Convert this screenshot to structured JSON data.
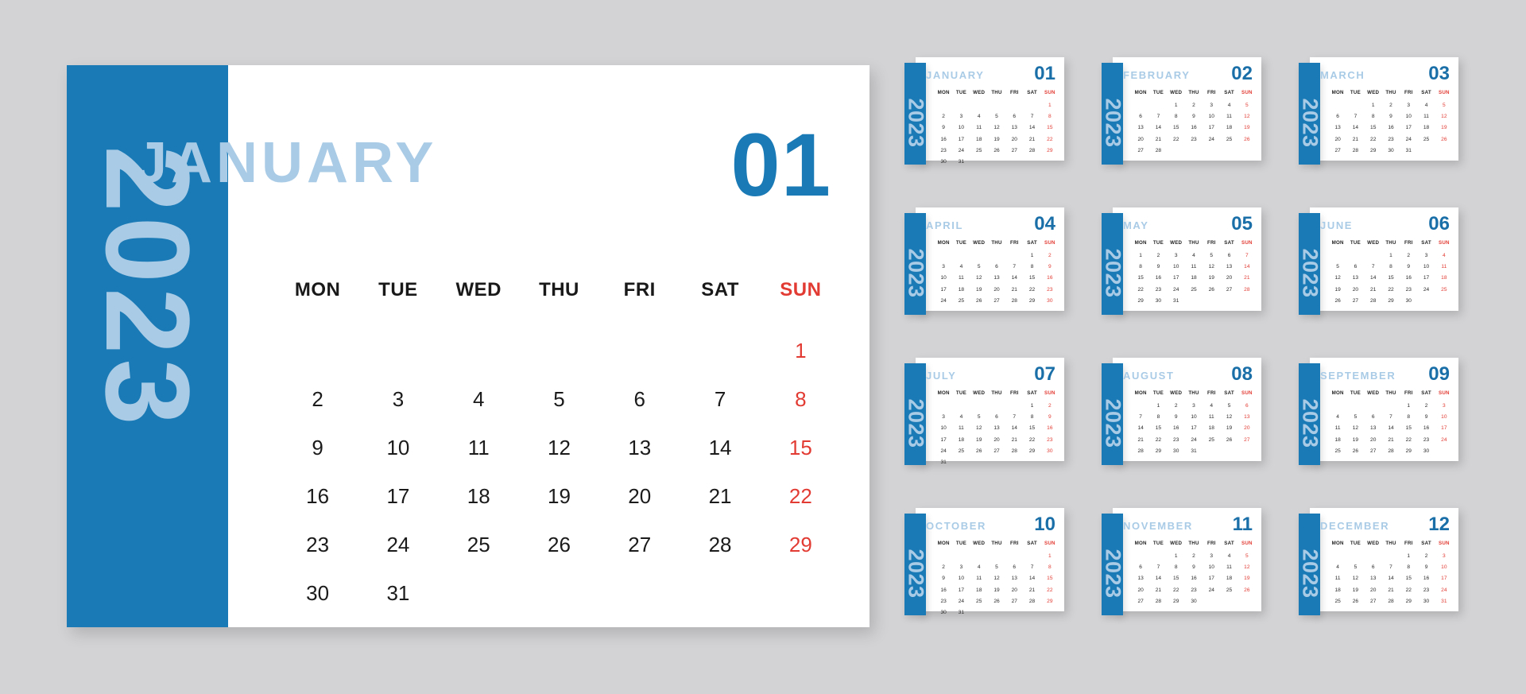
{
  "theme": {
    "background": "#d3d3d5",
    "card_background": "#ffffff",
    "accent_blue": "#1a7ab5",
    "light_blue": "#a9cbe6",
    "number_blue": "#1a6fa8",
    "sunday_red": "#e23b33",
    "text_dark": "#1b1b1b"
  },
  "year": "2023",
  "weekday_headers": [
    "MON",
    "TUE",
    "WED",
    "THU",
    "FRI",
    "SAT",
    "SUN"
  ],
  "featured": {
    "month_name": "JANUARY",
    "month_number": "01",
    "year": "2023",
    "weekday_headers": [
      "MON",
      "TUE",
      "WED",
      "THU",
      "FRI",
      "SAT",
      "SUN"
    ],
    "weeks": [
      [
        "",
        "",
        "",
        "",
        "",
        "",
        "1"
      ],
      [
        "2",
        "3",
        "4",
        "5",
        "6",
        "7",
        "8"
      ],
      [
        "9",
        "10",
        "11",
        "12",
        "13",
        "14",
        "15"
      ],
      [
        "16",
        "17",
        "18",
        "19",
        "20",
        "21",
        "22"
      ],
      [
        "23",
        "24",
        "25",
        "26",
        "27",
        "28",
        "29"
      ],
      [
        "30",
        "31",
        "",
        "",
        "",
        "",
        ""
      ]
    ]
  },
  "months": [
    {
      "month_name": "JANUARY",
      "month_number": "01",
      "year": "2023",
      "weeks": [
        [
          "",
          "",
          "",
          "",
          "",
          "",
          "1"
        ],
        [
          "2",
          "3",
          "4",
          "5",
          "6",
          "7",
          "8"
        ],
        [
          "9",
          "10",
          "11",
          "12",
          "13",
          "14",
          "15"
        ],
        [
          "16",
          "17",
          "18",
          "19",
          "20",
          "21",
          "22"
        ],
        [
          "23",
          "24",
          "25",
          "26",
          "27",
          "28",
          "29"
        ],
        [
          "30",
          "31",
          "",
          "",
          "",
          "",
          ""
        ]
      ]
    },
    {
      "month_name": "FEBRUARY",
      "month_number": "02",
      "year": "2023",
      "weeks": [
        [
          "",
          "",
          "1",
          "2",
          "3",
          "4",
          "5"
        ],
        [
          "6",
          "7",
          "8",
          "9",
          "10",
          "11",
          "12"
        ],
        [
          "13",
          "14",
          "15",
          "16",
          "17",
          "18",
          "19"
        ],
        [
          "20",
          "21",
          "22",
          "23",
          "24",
          "25",
          "26"
        ],
        [
          "27",
          "28",
          "",
          "",
          "",
          "",
          ""
        ],
        [
          "",
          "",
          "",
          "",
          "",
          "",
          ""
        ]
      ]
    },
    {
      "month_name": "MARCH",
      "month_number": "03",
      "year": "2023",
      "weeks": [
        [
          "",
          "",
          "1",
          "2",
          "3",
          "4",
          "5"
        ],
        [
          "6",
          "7",
          "8",
          "9",
          "10",
          "11",
          "12"
        ],
        [
          "13",
          "14",
          "15",
          "16",
          "17",
          "18",
          "19"
        ],
        [
          "20",
          "21",
          "22",
          "23",
          "24",
          "25",
          "26"
        ],
        [
          "27",
          "28",
          "29",
          "30",
          "31",
          "",
          ""
        ],
        [
          "",
          "",
          "",
          "",
          "",
          "",
          ""
        ]
      ]
    },
    {
      "month_name": "APRIL",
      "month_number": "04",
      "year": "2023",
      "weeks": [
        [
          "",
          "",
          "",
          "",
          "",
          "1",
          "2"
        ],
        [
          "3",
          "4",
          "5",
          "6",
          "7",
          "8",
          "9"
        ],
        [
          "10",
          "11",
          "12",
          "13",
          "14",
          "15",
          "16"
        ],
        [
          "17",
          "18",
          "19",
          "20",
          "21",
          "22",
          "23"
        ],
        [
          "24",
          "25",
          "26",
          "27",
          "28",
          "29",
          "30"
        ],
        [
          "",
          "",
          "",
          "",
          "",
          "",
          ""
        ]
      ]
    },
    {
      "month_name": "MAY",
      "month_number": "05",
      "year": "2023",
      "weeks": [
        [
          "1",
          "2",
          "3",
          "4",
          "5",
          "6",
          "7"
        ],
        [
          "8",
          "9",
          "10",
          "11",
          "12",
          "13",
          "14"
        ],
        [
          "15",
          "16",
          "17",
          "18",
          "19",
          "20",
          "21"
        ],
        [
          "22",
          "23",
          "24",
          "25",
          "26",
          "27",
          "28"
        ],
        [
          "29",
          "30",
          "31",
          "",
          "",
          "",
          ""
        ],
        [
          "",
          "",
          "",
          "",
          "",
          "",
          ""
        ]
      ]
    },
    {
      "month_name": "JUNE",
      "month_number": "06",
      "year": "2023",
      "weeks": [
        [
          "",
          "",
          "",
          "1",
          "2",
          "3",
          "4"
        ],
        [
          "5",
          "6",
          "7",
          "8",
          "9",
          "10",
          "11"
        ],
        [
          "12",
          "13",
          "14",
          "15",
          "16",
          "17",
          "18"
        ],
        [
          "19",
          "20",
          "21",
          "22",
          "23",
          "24",
          "25"
        ],
        [
          "26",
          "27",
          "28",
          "29",
          "30",
          "",
          ""
        ],
        [
          "",
          "",
          "",
          "",
          "",
          "",
          ""
        ]
      ]
    },
    {
      "month_name": "JULY",
      "month_number": "07",
      "year": "2023",
      "weeks": [
        [
          "",
          "",
          "",
          "",
          "",
          "1",
          "2"
        ],
        [
          "3",
          "4",
          "5",
          "6",
          "7",
          "8",
          "9"
        ],
        [
          "10",
          "11",
          "12",
          "13",
          "14",
          "15",
          "16"
        ],
        [
          "17",
          "18",
          "19",
          "20",
          "21",
          "22",
          "23"
        ],
        [
          "24",
          "25",
          "26",
          "27",
          "28",
          "29",
          "30"
        ],
        [
          "31",
          "",
          "",
          "",
          "",
          "",
          ""
        ]
      ]
    },
    {
      "month_name": "AUGUST",
      "month_number": "08",
      "year": "2023",
      "weeks": [
        [
          "",
          "1",
          "2",
          "3",
          "4",
          "5",
          "6"
        ],
        [
          "7",
          "8",
          "9",
          "10",
          "11",
          "12",
          "13"
        ],
        [
          "14",
          "15",
          "16",
          "17",
          "18",
          "19",
          "20"
        ],
        [
          "21",
          "22",
          "23",
          "24",
          "25",
          "26",
          "27"
        ],
        [
          "28",
          "29",
          "30",
          "31",
          "",
          "",
          ""
        ],
        [
          "",
          "",
          "",
          "",
          "",
          "",
          ""
        ]
      ]
    },
    {
      "month_name": "SEPTEMBER",
      "month_number": "09",
      "year": "2023",
      "weeks": [
        [
          "",
          "",
          "",
          "",
          "1",
          "2",
          "3"
        ],
        [
          "4",
          "5",
          "6",
          "7",
          "8",
          "9",
          "10"
        ],
        [
          "11",
          "12",
          "13",
          "14",
          "15",
          "16",
          "17"
        ],
        [
          "18",
          "19",
          "20",
          "21",
          "22",
          "23",
          "24"
        ],
        [
          "25",
          "26",
          "27",
          "28",
          "29",
          "30",
          ""
        ],
        [
          "",
          "",
          "",
          "",
          "",
          "",
          ""
        ]
      ]
    },
    {
      "month_name": "OCTOBER",
      "month_number": "10",
      "year": "2023",
      "weeks": [
        [
          "",
          "",
          "",
          "",
          "",
          "",
          "1"
        ],
        [
          "2",
          "3",
          "4",
          "5",
          "6",
          "7",
          "8"
        ],
        [
          "9",
          "10",
          "11",
          "12",
          "13",
          "14",
          "15"
        ],
        [
          "16",
          "17",
          "18",
          "19",
          "20",
          "21",
          "22"
        ],
        [
          "23",
          "24",
          "25",
          "26",
          "27",
          "28",
          "29"
        ],
        [
          "30",
          "31",
          "",
          "",
          "",
          "",
          ""
        ]
      ]
    },
    {
      "month_name": "NOVEMBER",
      "month_number": "11",
      "year": "2023",
      "weeks": [
        [
          "",
          "",
          "1",
          "2",
          "3",
          "4",
          "5"
        ],
        [
          "6",
          "7",
          "8",
          "9",
          "10",
          "11",
          "12"
        ],
        [
          "13",
          "14",
          "15",
          "16",
          "17",
          "18",
          "19"
        ],
        [
          "20",
          "21",
          "22",
          "23",
          "24",
          "25",
          "26"
        ],
        [
          "27",
          "28",
          "29",
          "30",
          "",
          "",
          ""
        ],
        [
          "",
          "",
          "",
          "",
          "",
          "",
          ""
        ]
      ]
    },
    {
      "month_name": "DECEMBER",
      "month_number": "12",
      "year": "2023",
      "weeks": [
        [
          "",
          "",
          "",
          "",
          "1",
          "2",
          "3"
        ],
        [
          "4",
          "5",
          "6",
          "7",
          "8",
          "9",
          "10"
        ],
        [
          "11",
          "12",
          "13",
          "14",
          "15",
          "16",
          "17"
        ],
        [
          "18",
          "19",
          "20",
          "21",
          "22",
          "23",
          "24"
        ],
        [
          "25",
          "26",
          "27",
          "28",
          "29",
          "30",
          "31"
        ],
        [
          "",
          "",
          "",
          "",
          "",
          "",
          ""
        ]
      ]
    }
  ]
}
